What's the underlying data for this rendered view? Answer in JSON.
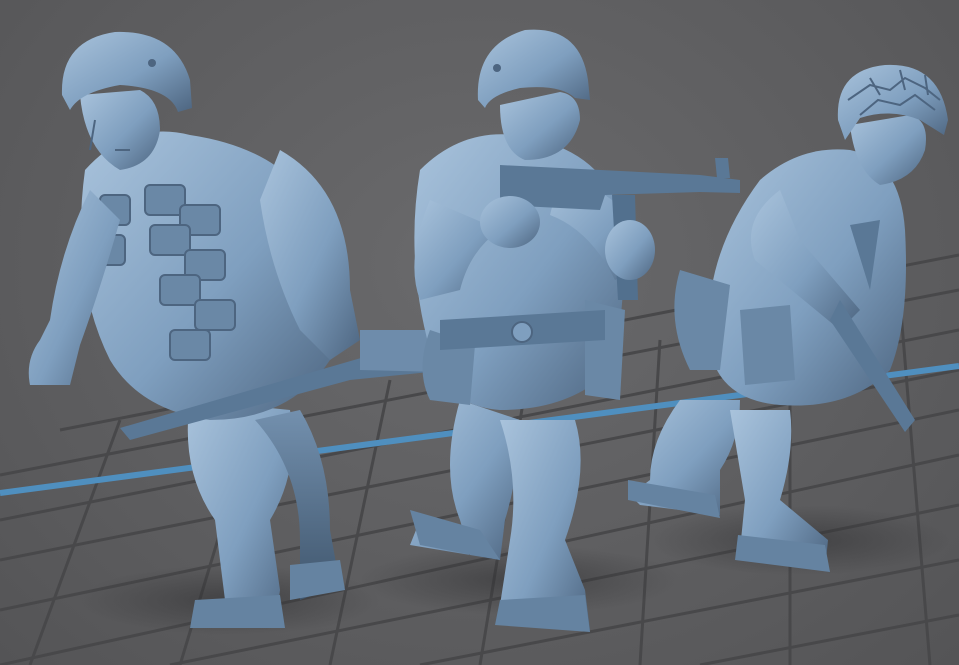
{
  "viewer": {
    "background_color": "#5e5e60",
    "grid_color": "#4a4a4c",
    "axis_color": "#4f8fbf",
    "model_color": "#7f9fbf",
    "model_shadow_color": "#4d6580",
    "model_highlight_color": "#a9c3dc"
  },
  "models": [
    {
      "name": "paratrooper-with-rifle"
    },
    {
      "name": "paratrooper-with-smg"
    },
    {
      "name": "paratrooper-with-camo-helmet"
    }
  ]
}
